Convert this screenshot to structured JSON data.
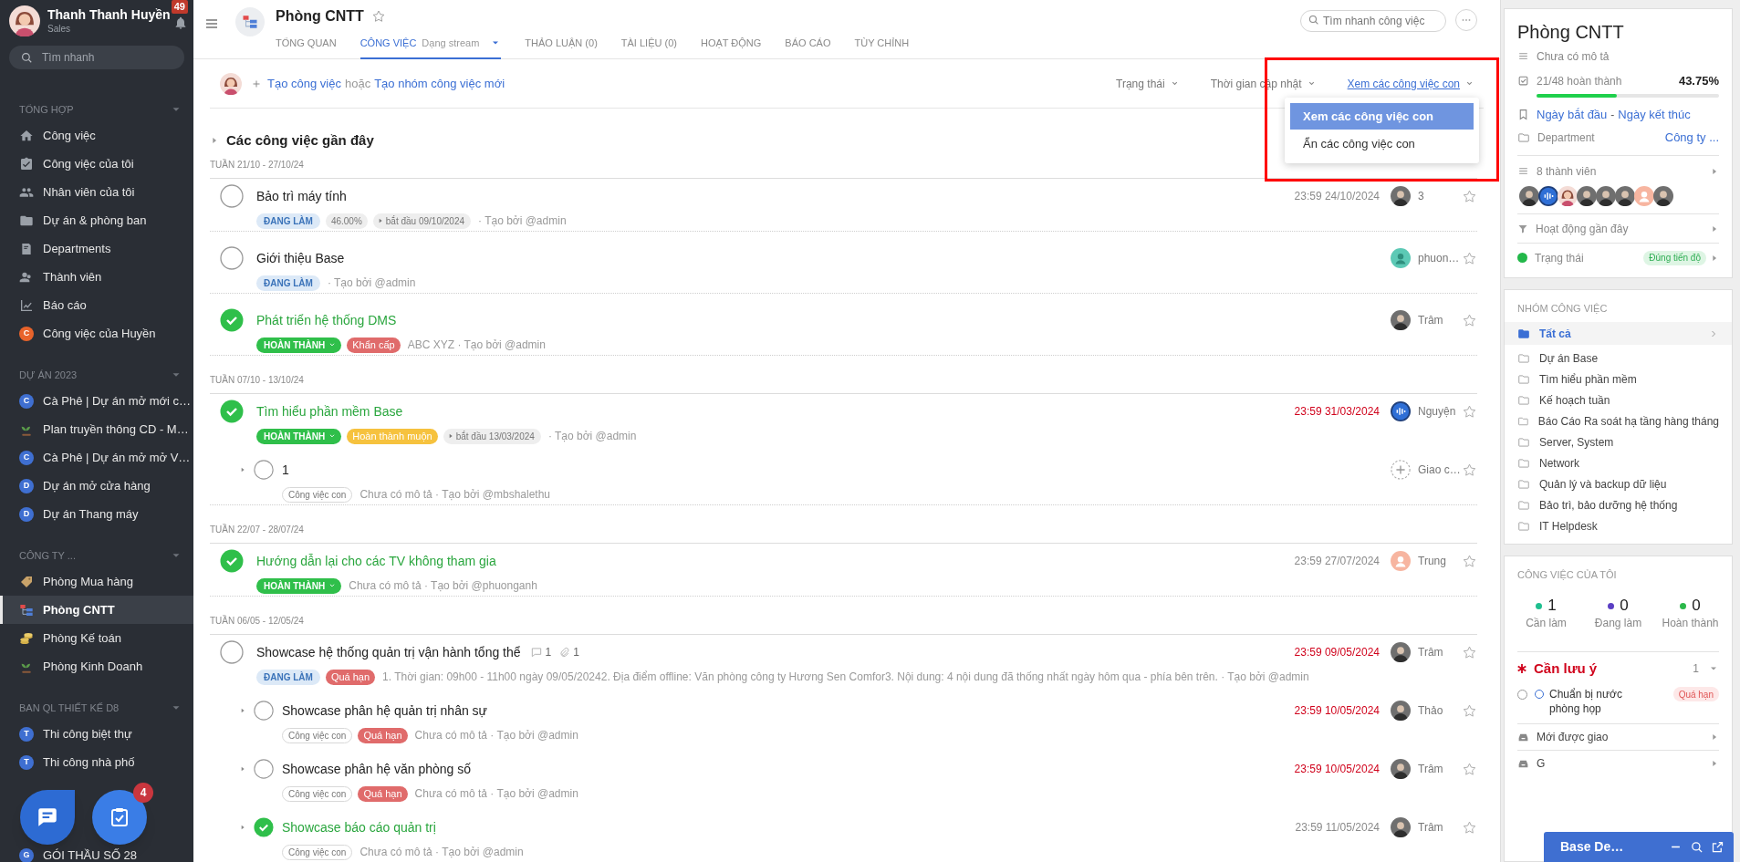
{
  "user": {
    "name": "Thanh Thanh Huyền",
    "role": "Sales",
    "notifications": "49"
  },
  "sidebar": {
    "search_placeholder": "Tìm nhanh",
    "sections": [
      {
        "title": "TỔNG HỢP",
        "items": [
          {
            "label": "Công việc",
            "kind": "home",
            "selected": false
          },
          {
            "label": "Công việc của tôi",
            "kind": "clipboard",
            "selected": false
          },
          {
            "label": "Nhân viên của tôi",
            "kind": "people",
            "selected": false
          },
          {
            "label": "Dự án & phòng ban",
            "kind": "folder",
            "selected": false
          },
          {
            "label": "Departments",
            "kind": "department",
            "selected": false
          },
          {
            "label": "Thành viên",
            "kind": "members",
            "selected": false
          },
          {
            "label": "Báo cáo",
            "kind": "chart",
            "selected": false
          },
          {
            "label": "Công việc của Huyền",
            "kind": "letter",
            "letter": "C",
            "color": "#e8632b",
            "selected": false
          }
        ]
      },
      {
        "title": "DỰ ÁN 2023",
        "items": [
          {
            "label": "Cà Phê | Dự án mở mới c…",
            "kind": "letter",
            "letter": "C",
            "color": "#3f6fd1",
            "selected": false
          },
          {
            "label": "Plan truyền thông CD - M…",
            "kind": "sprout",
            "selected": false
          },
          {
            "label": "Cà Phê | Dự án mở mở V…",
            "kind": "letter",
            "letter": "C",
            "color": "#3f6fd1",
            "selected": false
          },
          {
            "label": "Dự án mở cửa hàng",
            "kind": "letter",
            "letter": "D",
            "color": "#3f6fd1",
            "selected": false
          },
          {
            "label": "Dự án Thang máy",
            "kind": "letter",
            "letter": "D",
            "color": "#3f6fd1",
            "selected": false
          }
        ]
      },
      {
        "title": "CÔNG TY ...",
        "items": [
          {
            "label": "Phòng Mua hàng",
            "kind": "tag",
            "selected": false
          },
          {
            "label": "Phòng CNTT",
            "kind": "org",
            "selected": true
          },
          {
            "label": "Phòng Kế toán",
            "kind": "coins",
            "selected": false
          },
          {
            "label": "Phòng Kinh Doanh",
            "kind": "sprout",
            "selected": false
          }
        ]
      },
      {
        "title": "BAN QL THIẾT KẾ D8",
        "items": [
          {
            "label": "Thi công biệt thự",
            "kind": "letter",
            "letter": "T",
            "color": "#3f6fd1",
            "selected": false
          },
          {
            "label": "Thi công nhà phố",
            "kind": "letter",
            "letter": "T",
            "color": "#3f6fd1",
            "selected": false
          }
        ]
      },
      {
        "items": [
          {
            "label": "GÓI THẦU SỐ 28",
            "kind": "letter",
            "letter": "G",
            "color": "#3f6fd1",
            "selected": false
          }
        ]
      }
    ]
  },
  "floating_buttons": {
    "tasks_badge": "4"
  },
  "header": {
    "title": "Phòng CNTT",
    "tabs": [
      {
        "label": "TỔNG QUAN",
        "selected": false
      },
      {
        "label": "CÔNG VIỆC",
        "sub": "Dạng stream",
        "selected": true
      },
      {
        "label": "THẢO LUẬN (0)",
        "selected": false
      },
      {
        "label": "TÀI LIỆU (0)",
        "selected": false
      },
      {
        "label": "HOẠT ĐỘNG",
        "selected": false
      },
      {
        "label": "BÁO CÁO",
        "selected": false
      },
      {
        "label": "TÙY CHỈNH",
        "selected": false
      }
    ],
    "search_placeholder": "Tìm nhanh công việc"
  },
  "toolbar": {
    "create_task": "Tạo công việc",
    "or": "hoặc",
    "create_group": "Tạo nhóm công việc mới",
    "filters": [
      {
        "label": "Trạng thái",
        "active": false
      },
      {
        "label": "Thời gian cập nhật",
        "active": false
      },
      {
        "label": "Xem các công việc con",
        "active": true
      }
    ]
  },
  "dropdown": {
    "items": [
      {
        "label": "Xem các công việc con",
        "selected": true
      },
      {
        "label": "Ẩn các công việc con",
        "selected": false
      }
    ]
  },
  "section_title": "Các công việc gần đây",
  "weeks": [
    {
      "label": "TUẦN 21/10 - 27/10/24",
      "tasks": [
        {
          "title": "Bảo trì máy tính",
          "done": false,
          "tags": [
            {
              "kind": "doing",
              "text": "ĐANG LÀM"
            },
            {
              "kind": "plain",
              "text": "46.00%"
            },
            {
              "kind": "start",
              "text": "bắt đầu 09/10/2024"
            }
          ],
          "meta": "· Tạo bởi @admin",
          "due": "23:59 24/10/2024",
          "overdue": false,
          "assignee": {
            "kind": "photo",
            "name": "3"
          }
        },
        {
          "title": "Giới thiệu Base",
          "done": false,
          "tags": [
            {
              "kind": "doing",
              "text": "ĐANG LÀM"
            }
          ],
          "meta": "· Tạo bởi @admin",
          "assignee": {
            "kind": "teal",
            "name": "phuon…"
          }
        },
        {
          "title": "Phát triển hệ thống DMS",
          "done": true,
          "tags": [
            {
              "kind": "done",
              "text": "HOÀN THÀNH"
            },
            {
              "kind": "urgent",
              "text": "Khẩn cấp"
            }
          ],
          "meta": "ABC XYZ · Tạo bởi @admin",
          "assignee": {
            "kind": "photo",
            "name": "Trâm"
          }
        }
      ]
    },
    {
      "label": "TUẦN 07/10 - 13/10/24",
      "tasks": [
        {
          "title": "Tìm hiểu phần mềm Base",
          "done": true,
          "tags": [
            {
              "kind": "done",
              "text": "HOÀN THÀNH"
            },
            {
              "kind": "late",
              "text": "Hoàn thành muộn"
            },
            {
              "kind": "start",
              "text": "bắt đầu 13/03/2024"
            }
          ],
          "meta": "· Tạo bởi @admin",
          "due": "23:59 31/03/2024",
          "overdue": true,
          "assignee": {
            "kind": "wave",
            "name": "Nguyện"
          },
          "children": [
            {
              "title": "1",
              "done": false,
              "tags": [
                {
                  "kind": "subtask",
                  "text": "Công việc con"
                }
              ],
              "meta": "Chưa có mô tả · Tạo bởi @mbshalethu",
              "assignee": {
                "kind": "add",
                "name": "Giao c…"
              }
            }
          ]
        }
      ]
    },
    {
      "label": "TUẦN 22/07 - 28/07/24",
      "tasks": [
        {
          "title": "Hướng dẫn lại cho các TV không tham gia",
          "done": true,
          "tags": [
            {
              "kind": "done",
              "text": "HOÀN THÀNH"
            }
          ],
          "meta": "Chưa có mô tả · Tạo bởi @phuonganh",
          "due": "23:59 27/07/2024",
          "overdue": false,
          "assignee": {
            "kind": "peach",
            "name": "Trung"
          }
        }
      ]
    },
    {
      "label": "TUẦN 06/05 - 12/05/24",
      "tasks": [
        {
          "title": "Showcase hệ thống quản trị vận hành tổng thể",
          "comments": "1",
          "attachments": "1",
          "done": false,
          "tags": [
            {
              "kind": "doing",
              "text": "ĐANG LÀM"
            },
            {
              "kind": "urgent",
              "text": "Quá hạn"
            }
          ],
          "meta": "1. Thời gian: 09h00 - 11h00 ngày 09/05/20242. Địa điểm offline: Văn phòng công ty Hương Sen Comfor3. Nội dung: 4 nội dung đã thống nhất ngày hôm qua - phía bên trên. · Tạo bởi @admin",
          "due": "23:59 09/05/2024",
          "overdue": true,
          "assignee": {
            "kind": "photo",
            "name": "Trâm"
          },
          "children": [
            {
              "title": "Showcase phân hệ quản trị nhân sự",
              "done": false,
              "tags": [
                {
                  "kind": "subtask",
                  "text": "Công việc con"
                },
                {
                  "kind": "urgent",
                  "text": "Quá hạn"
                }
              ],
              "meta": "Chưa có mô tả · Tạo bởi @admin",
              "due": "23:59 10/05/2024",
              "overdue": true,
              "assignee": {
                "kind": "photo",
                "name": "Thảo"
              }
            },
            {
              "title": "Showcase phân hệ văn phòng số",
              "done": false,
              "tags": [
                {
                  "kind": "subtask",
                  "text": "Công việc con"
                },
                {
                  "kind": "urgent",
                  "text": "Quá hạn"
                }
              ],
              "meta": "Chưa có mô tả · Tạo bởi @admin",
              "due": "23:59 10/05/2024",
              "overdue": true,
              "assignee": {
                "kind": "photo",
                "name": "Trâm"
              }
            },
            {
              "title": "Showcase báo cáo quản trị",
              "done": true,
              "tags": [
                {
                  "kind": "subtask",
                  "text": "Công việc con"
                }
              ],
              "meta": "Chưa có mô tả · Tạo bởi @admin",
              "due": "23:59 11/05/2024",
              "overdue": false,
              "assignee": {
                "kind": "photo",
                "name": "Trâm"
              }
            }
          ]
        }
      ]
    }
  ],
  "project": {
    "title": "Phòng CNTT",
    "description": "Chưa có mô tả",
    "progress": "21/48 hoàn thành",
    "percent": "43.75%",
    "level": 0.4375,
    "start": "Ngày bắt đầu",
    "dash": "-",
    "end": "Ngày kết thúc",
    "department_label": "Department",
    "department_value": "Công ty ...",
    "members_label": "8 thành viên",
    "members": [
      {
        "kind": "photo"
      },
      {
        "kind": "wave"
      },
      {
        "kind": "cartoon"
      },
      {
        "kind": "photo"
      },
      {
        "kind": "photo"
      },
      {
        "kind": "photo"
      },
      {
        "kind": "peach"
      },
      {
        "kind": "photo"
      }
    ],
    "activity": "Hoạt động gần đây",
    "status_label": "Trạng thái",
    "status_badge": "Đúng tiến độ"
  },
  "groups": {
    "title": "NHÓM CÔNG VIỆC",
    "items": [
      {
        "label": "Tất cả",
        "selected": true
      },
      {
        "label": "Dự án Base",
        "selected": false
      },
      {
        "label": "Tìm hiểu phần mềm",
        "selected": false
      },
      {
        "label": "Kế hoạch tuần",
        "selected": false
      },
      {
        "label": "Báo Cáo Ra soát hạ tầng hàng tháng",
        "selected": false
      },
      {
        "label": "Server, System",
        "selected": false
      },
      {
        "label": "Network",
        "selected": false
      },
      {
        "label": "Quản lý và backup dữ liệu",
        "selected": false
      },
      {
        "label": "Bảo trì, bảo dưỡng hệ thống",
        "selected": false
      },
      {
        "label": "IT Helpdesk",
        "selected": false
      }
    ]
  },
  "my_tasks": {
    "title": "CÔNG VIỆC CỦA TÔI",
    "stats": [
      {
        "value": "1",
        "label": "Cần làm",
        "color": "#1fbf8f"
      },
      {
        "value": "0",
        "label": "Đang làm",
        "color": "#5b3fc4"
      },
      {
        "value": "0",
        "label": "Hoàn thành",
        "color": "#2bb84a"
      }
    ],
    "attention_title": "Cần lưu ý",
    "attention_count": "1",
    "attention_items": [
      {
        "title": "Chuẩn bị nước phòng họp",
        "badge": "Quá hạn",
        "checked": false
      }
    ],
    "links": [
      "Mới được giao",
      "G"
    ]
  },
  "chat_bar": {
    "title": "Base De…"
  }
}
